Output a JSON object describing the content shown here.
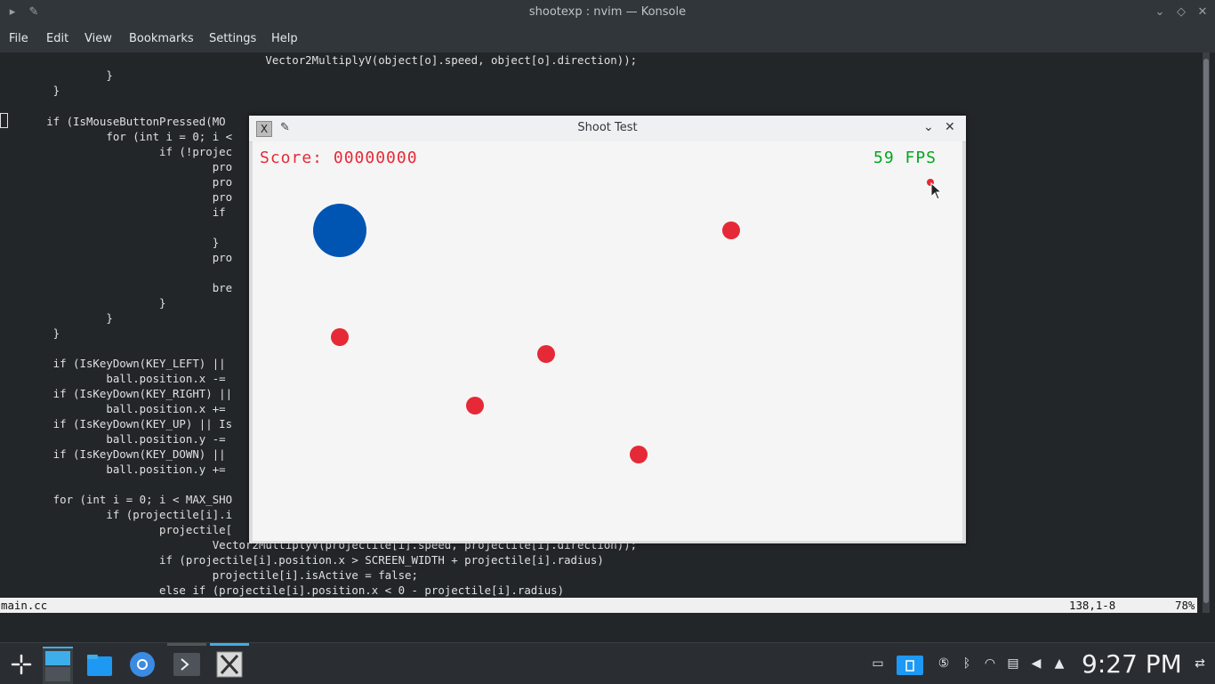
{
  "window": {
    "title": "shootexp : nvim — Konsole"
  },
  "menu": [
    "File",
    "Edit",
    "View",
    "Bookmarks",
    "Settings",
    "Help"
  ],
  "editor": {
    "filename": "main.cc",
    "position": "138,1-8",
    "percent": "78%",
    "lines": [
      "                                        Vector2MultiplyV(object[o].speed, object[o].direction));",
      "                }",
      "        }",
      "",
      "       if (IsMouseButtonPressed(MO",
      "                for (int i = 0; i <",
      "                        if (!projec",
      "                                pro",
      "                                pro",
      "                                pro",
      "                                if",
      "",
      "                                }",
      "                                pro",
      "",
      "                                bre",
      "                        }",
      "                }",
      "        }",
      "",
      "        if (IsKeyDown(KEY_LEFT) ||",
      "                ball.position.x -=",
      "        if (IsKeyDown(KEY_RIGHT) ||",
      "                ball.position.x +=",
      "        if (IsKeyDown(KEY_UP) || Is",
      "                ball.position.y -=",
      "        if (IsKeyDown(KEY_DOWN) ||",
      "                ball.position.y +=",
      "",
      "        for (int i = 0; i < MAX_SHO",
      "                if (projectile[i].i",
      "                        projectile[",
      "                                Vector2MultiplyV(projectile[i].speed, projectile[i].direction));",
      "                        if (projectile[i].position.x > SCREEN_WIDTH + projectile[i].radius)",
      "                                projectile[i].isActive = false;",
      "                        else if (projectile[i].position.x < 0 - projectile[i].radius)"
    ]
  },
  "game": {
    "title": "Shoot Test",
    "score": "Score: 00000000",
    "fps": "59 FPS"
  },
  "taskbar": {
    "clock": "9:27 PM"
  },
  "colors": {
    "score": "#e62937",
    "fps": "#00a81c",
    "ball": "#0055b3",
    "projectile": "#e62937"
  }
}
